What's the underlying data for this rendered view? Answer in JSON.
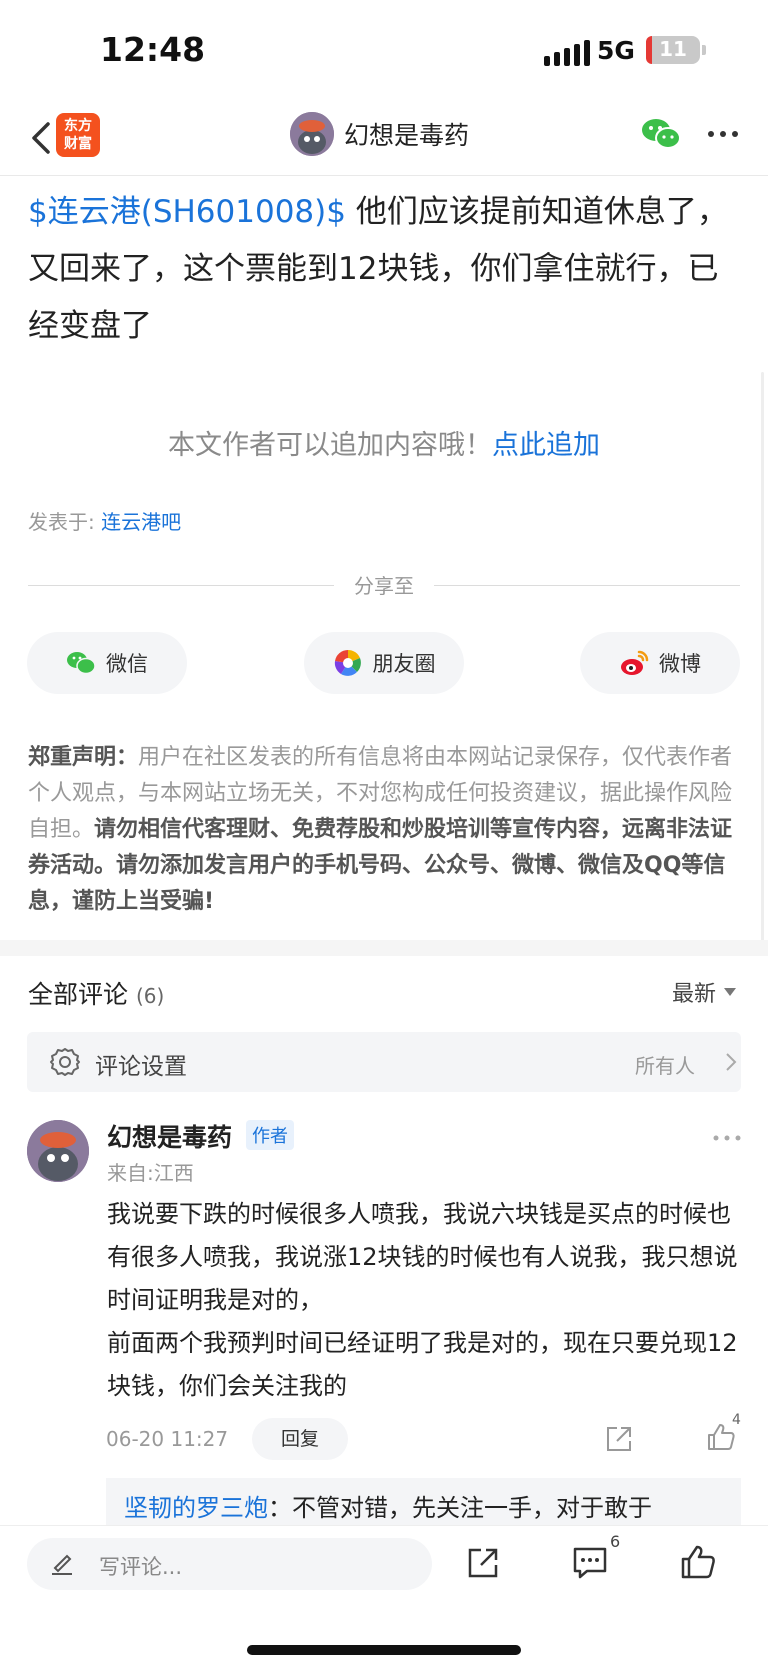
{
  "status_bar": {
    "time": "12:48",
    "network": "5G",
    "battery": "11",
    "battery_level_percent": 11
  },
  "nav": {
    "app_logo_line1": "东方",
    "app_logo_line2": "财富",
    "title": "幻想是毒药",
    "icons": [
      "back-icon",
      "wechat-icon",
      "more-icon"
    ]
  },
  "post": {
    "stock_tag": "$连云港(SH601008)$",
    "text": " 他们应该提前知道休息了，又回来了，这个票能到12块钱，你们拿住就行，已经变盘了"
  },
  "append": {
    "prompt": "本文作者可以追加内容哦！",
    "link": "点此追加"
  },
  "published": {
    "label": "发表于:",
    "forum": "连云港吧"
  },
  "share": {
    "title": "分享至",
    "wechat": "微信",
    "moments": "朋友圈",
    "weibo": "微博"
  },
  "disclaimer": {
    "label": "郑重声明：",
    "normal": "用户在社区发表的所有信息将由本网站记录保存，仅代表作者个人观点，与本网站立场无关，不对您构成任何投资建议，据此操作风险自担。",
    "bold": "请勿相信代客理财、免费荐股和炒股培训等宣传内容，远离非法证券活动。请勿添加发言用户的手机号码、公众号、微博、微信及QQ等信息，谨防上当受骗!"
  },
  "comments": {
    "header": "全部评论",
    "count": "(6)",
    "sort": "最新",
    "settings_label": "评论设置",
    "settings_value": "所有人",
    "items": [
      {
        "name": "幻想是毒药",
        "tag": "作者",
        "location": "来自:江西",
        "text_line1": "我说要下跌的时候很多人喷我，我说六块钱是买点的时候也有很多人喷我，我说涨12块钱的时候也有人说我，我只想说时间证明我是对的，",
        "text_line2": "前面两个我预判时间已经证明了我是对的，现在只要兑现12块钱，你们会关注我的",
        "time": "06-20 11:27",
        "reply_label": "回复",
        "like_count": "4",
        "reply": {
          "name": "坚韧的罗三炮",
          "text": "：不管对错，先关注一手，对于敢于"
        }
      }
    ]
  },
  "bottom_bar": {
    "placeholder": "写评论...",
    "comment_count": "6"
  }
}
